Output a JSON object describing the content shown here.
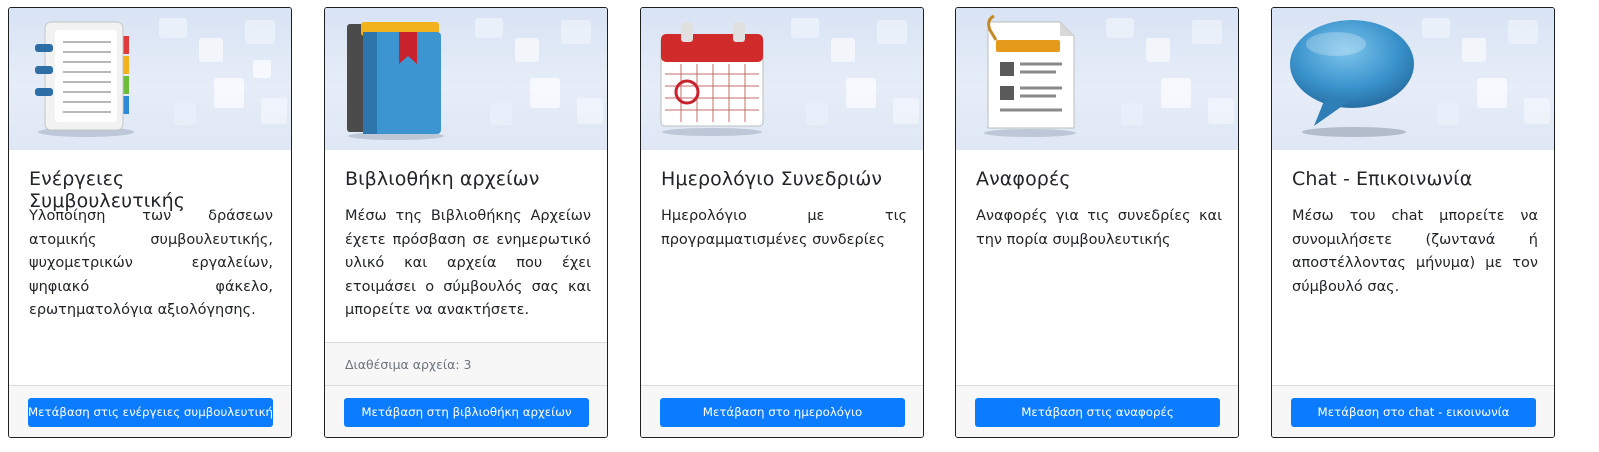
{
  "cards": [
    {
      "title": "Ενέργειες Συμβουλευτικής",
      "text": "Υλοποίηση των δράσεων ατομικής συμβουλευτικής, ψυχομετρικών εργαλείων, ψηφιακό φάκελο, ερωτηματολόγια αξιολόγησης.",
      "button": "Μετάβαση στις ενέργειες συμβουλευτικής",
      "icon": "address-book-icon"
    },
    {
      "title": "Βιβλιοθήκη αρχείων",
      "text": "Μέσω της Βιβλιοθήκης Αρχείων έχετε πρόσβαση σε ενημερωτικό υλικό και αρχεία που έχει ετοιμάσει ο σύμβουλός σας και μπορείτε να ανακτήσετε.",
      "meta": "Διαθέσιμα αρχεία: 3",
      "button": "Μετάβαση στη βιβλιοθήκη αρχείων",
      "icon": "books-icon"
    },
    {
      "title": "Ημερολόγιο Συνεδριών",
      "text": "Ημερολόγιο με τις προγραμματισμένες συνδερίες",
      "button": "Μετάβαση στο ημερολόγιο",
      "icon": "calendar-icon"
    },
    {
      "title": "Αναφορές",
      "text": "Αναφορές για τις συνεδρίες και την πορία συμβουλευτικής",
      "button": "Μετάβαση στις αναφορές",
      "icon": "report-document-icon"
    },
    {
      "title": "Chat - Επικοινωνία",
      "text": "Μέσω του chat μπορείτε να συνομιλήσετε (ζωντανά ή αποστέλλοντας μήνυμα) με τον σύμβουλό σας.",
      "button": "Μετάβαση στο chat - εικοινωνία",
      "icon": "speech-bubble-icon"
    }
  ],
  "colors": {
    "accent": "#0b7cff",
    "title": "#212529",
    "muted": "#6c757d",
    "footer_bg": "#f7f7f7"
  }
}
